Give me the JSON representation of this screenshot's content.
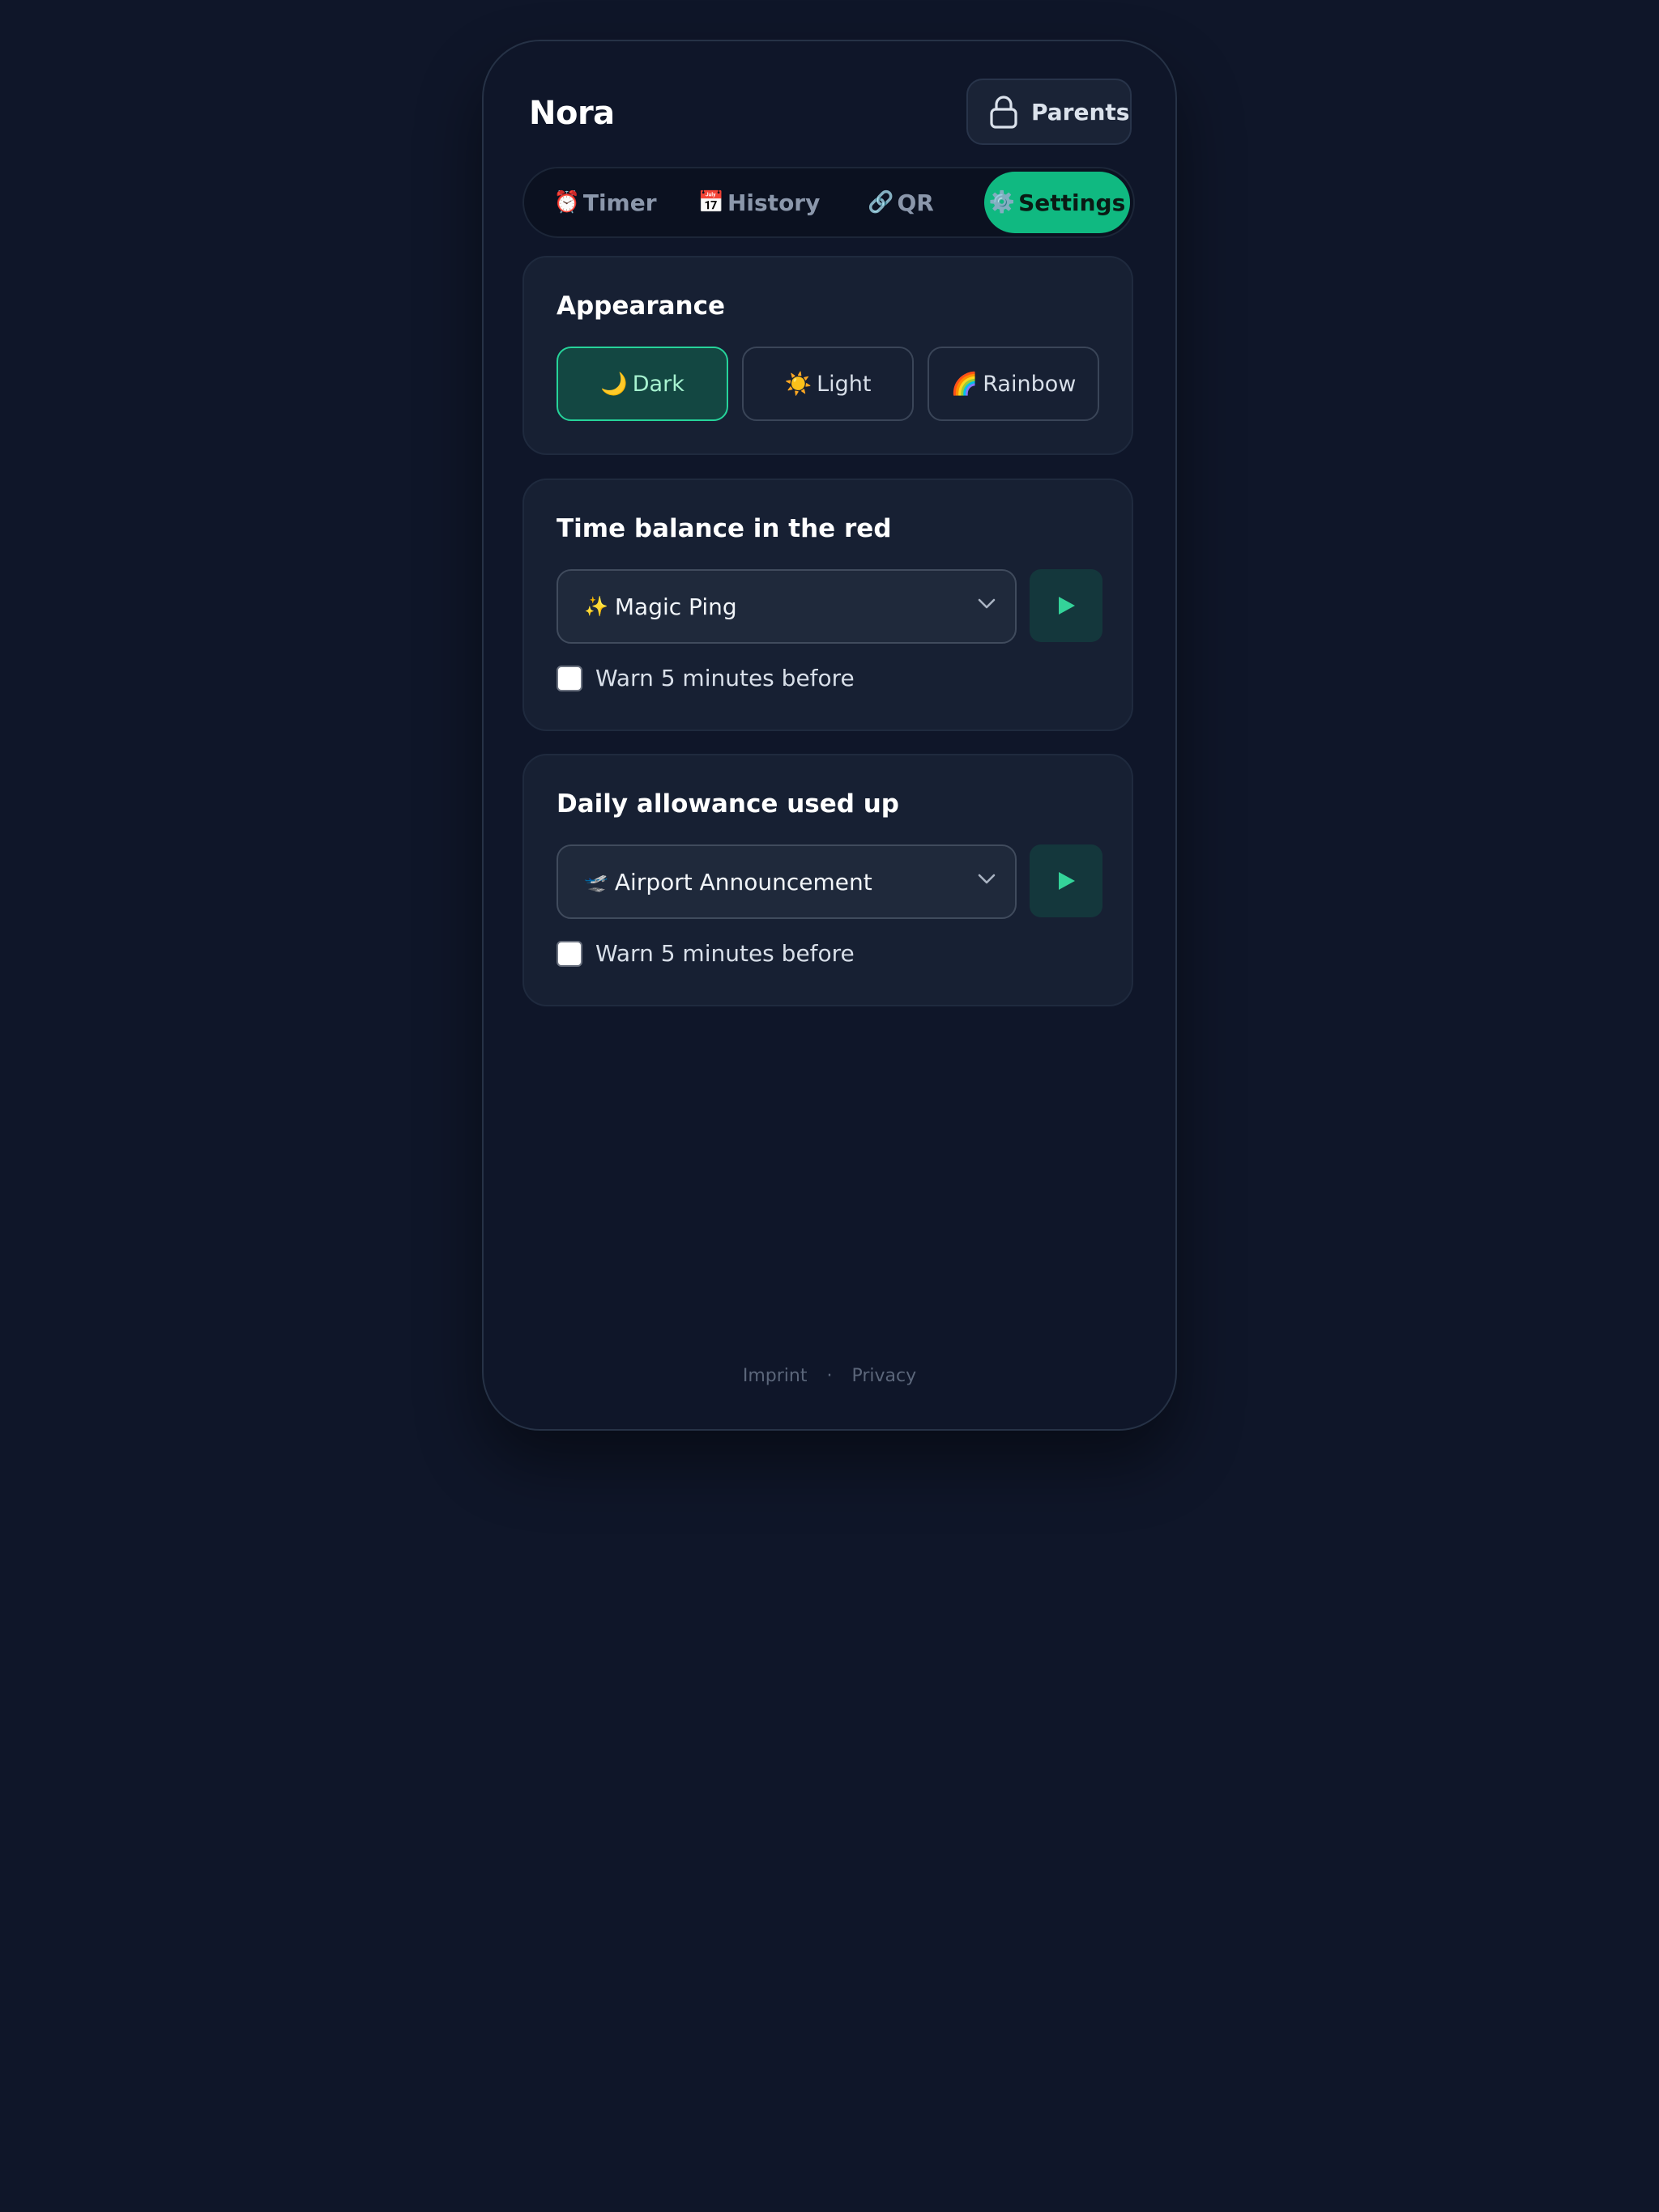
{
  "header": {
    "title": "Nora",
    "parents_label": "Parents",
    "parents_icon": "lock-icon"
  },
  "tabs": [
    {
      "emoji": "⏰",
      "label": "Timer",
      "icon": "alarm-clock-icon",
      "active": false
    },
    {
      "emoji": "📅",
      "label": "History",
      "icon": "calendar-icon",
      "active": false
    },
    {
      "emoji": "🔗",
      "label": "QR",
      "icon": "link-icon",
      "active": false
    },
    {
      "emoji": "⚙️",
      "label": "Settings",
      "icon": "gear-icon",
      "active": true
    }
  ],
  "appearance": {
    "title": "Appearance",
    "options": [
      {
        "emoji": "🌙",
        "label": "Dark",
        "selected": true
      },
      {
        "emoji": "☀️",
        "label": "Light",
        "selected": false
      },
      {
        "emoji": "🌈",
        "label": "Rainbow",
        "selected": false
      }
    ]
  },
  "negative_balance": {
    "title": "Time balance in the red",
    "sound_emoji": "✨",
    "sound_label": "Magic Ping",
    "warn_label": "Warn 5 minutes before",
    "warn_checked": false
  },
  "allowance_used": {
    "title": "Daily allowance used up",
    "sound_emoji": "🛫",
    "sound_label": "Airport Announcement",
    "warn_label": "Warn 5 minutes before",
    "warn_checked": false
  },
  "footer": {
    "imprint": "Imprint",
    "separator": "·",
    "privacy": "Privacy"
  },
  "colors": {
    "background": "#0f1629",
    "card": "#172033",
    "accent": "#10b981",
    "selected_bg": "#134742",
    "selected_border": "#26d39a"
  }
}
